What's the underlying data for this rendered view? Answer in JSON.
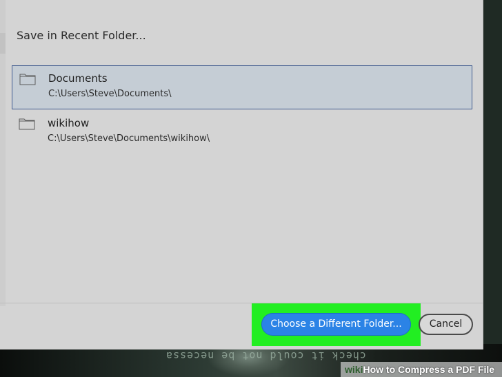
{
  "dialog": {
    "header": "Save in Recent Folder...",
    "folders": [
      {
        "name": "Documents",
        "path": "C:\\Users\\Steve\\Documents\\",
        "selected": true
      },
      {
        "name": "wikihow",
        "path": "C:\\Users\\Steve\\Documents\\wikihow\\",
        "selected": false
      }
    ],
    "primary_button": "Choose a Different Folder...",
    "cancel_button": "Cancel"
  },
  "background": {
    "scribble": "check it could not be necessa"
  },
  "watermark": {
    "brand": "wiki",
    "title": "How to Compress a PDF File"
  },
  "colors": {
    "highlight": "#22ee22",
    "primary": "#2b83e6",
    "selection": "#c5cdd5",
    "selection_border": "#3f5a8e"
  },
  "icons": {
    "folder": "folder-icon"
  }
}
